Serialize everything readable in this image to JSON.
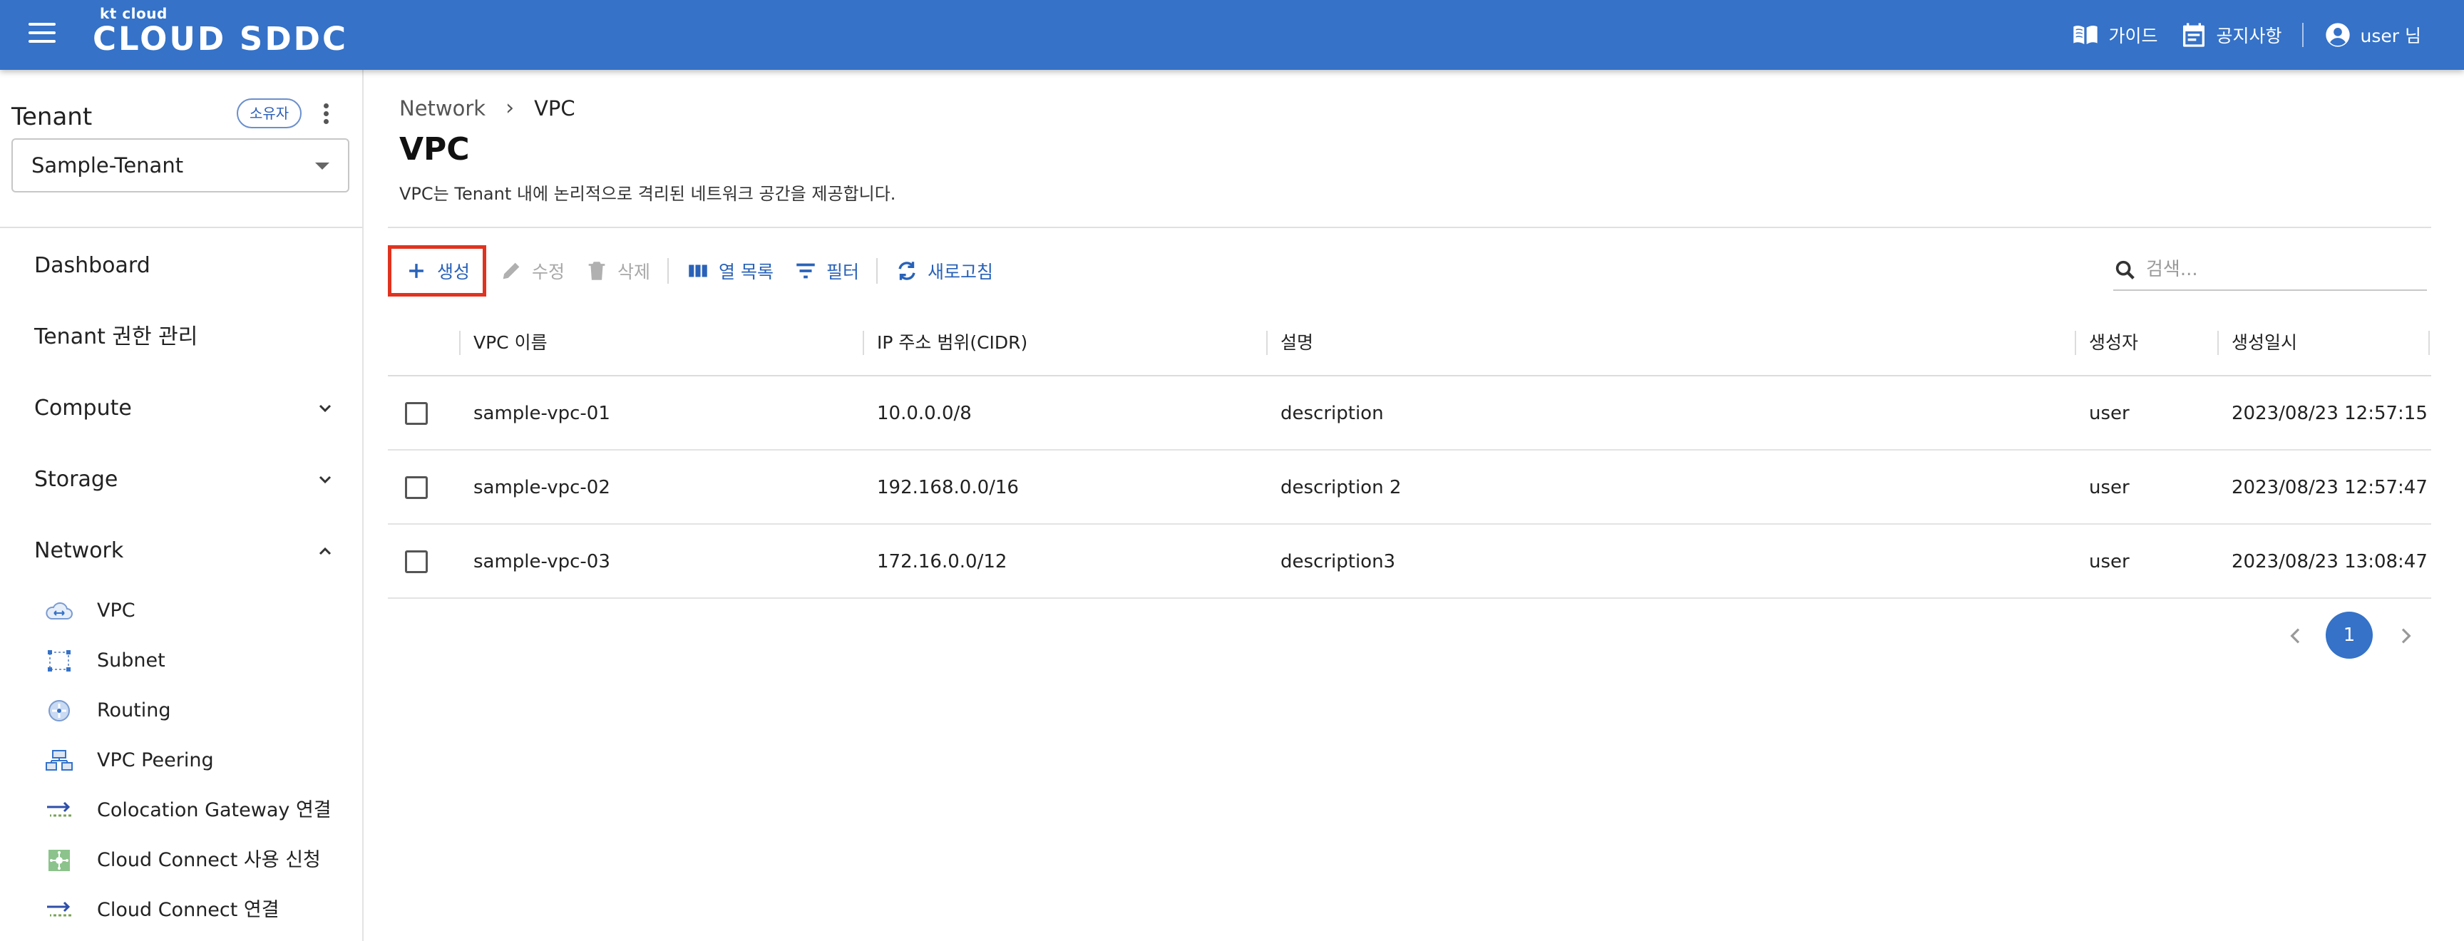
{
  "header": {
    "brand_small": "kt cloud",
    "brand_main": "CLOUD SDDC",
    "guide_label": "가이드",
    "notice_label": "공지사항",
    "user_label": "user 님",
    "bg_color": "#3572c8"
  },
  "sidebar": {
    "tenant_title": "Tenant",
    "owner_badge": "소유자",
    "selected_tenant": "Sample-Tenant",
    "nav": [
      {
        "label": "Dashboard",
        "expandable": false
      },
      {
        "label": "Tenant 권한 관리",
        "expandable": false
      },
      {
        "label": "Compute",
        "expandable": true,
        "expanded": false
      },
      {
        "label": "Storage",
        "expandable": true,
        "expanded": false
      },
      {
        "label": "Network",
        "expandable": true,
        "expanded": true
      }
    ],
    "network_items": [
      {
        "label": "VPC",
        "icon": "vpc-cloud-icon"
      },
      {
        "label": "Subnet",
        "icon": "subnet-icon"
      },
      {
        "label": "Routing",
        "icon": "routing-icon"
      },
      {
        "label": "VPC Peering",
        "icon": "vpc-peering-icon"
      },
      {
        "label": "Colocation Gateway 연결",
        "icon": "arrows-transfer-icon"
      },
      {
        "label": "Cloud Connect 사용 신청",
        "icon": "cloud-connect-icon"
      },
      {
        "label": "Cloud Connect 연결",
        "icon": "arrows-transfer-icon"
      }
    ]
  },
  "main": {
    "breadcrumb": [
      "Network",
      "VPC"
    ],
    "title": "VPC",
    "description": "VPC는 Tenant 내에 논리적으로 격리된 네트워크 공간을 제공합니다.",
    "toolbar": {
      "create": "생성",
      "edit": "수정",
      "delete": "삭제",
      "columns": "열 목록",
      "filter": "필터",
      "refresh": "새로고침"
    },
    "search": {
      "placeholder": "검색..."
    },
    "table": {
      "columns": [
        "VPC 이름",
        "IP 주소 범위(CIDR)",
        "설명",
        "생성자",
        "생성일시"
      ],
      "rows": [
        [
          "sample-vpc-01",
          "10.0.0.0/8",
          "description",
          "user",
          "2023/08/23 12:57:15"
        ],
        [
          "sample-vpc-02",
          "192.168.0.0/16",
          "description 2",
          "user",
          "2023/08/23 12:57:47"
        ],
        [
          "sample-vpc-03",
          "172.16.0.0/12",
          "description3",
          "user",
          "2023/08/23 13:08:47"
        ]
      ]
    },
    "pagination": {
      "current_page": "1"
    },
    "accent_color": "#2962b8",
    "highlight_color": "#e0331f"
  }
}
